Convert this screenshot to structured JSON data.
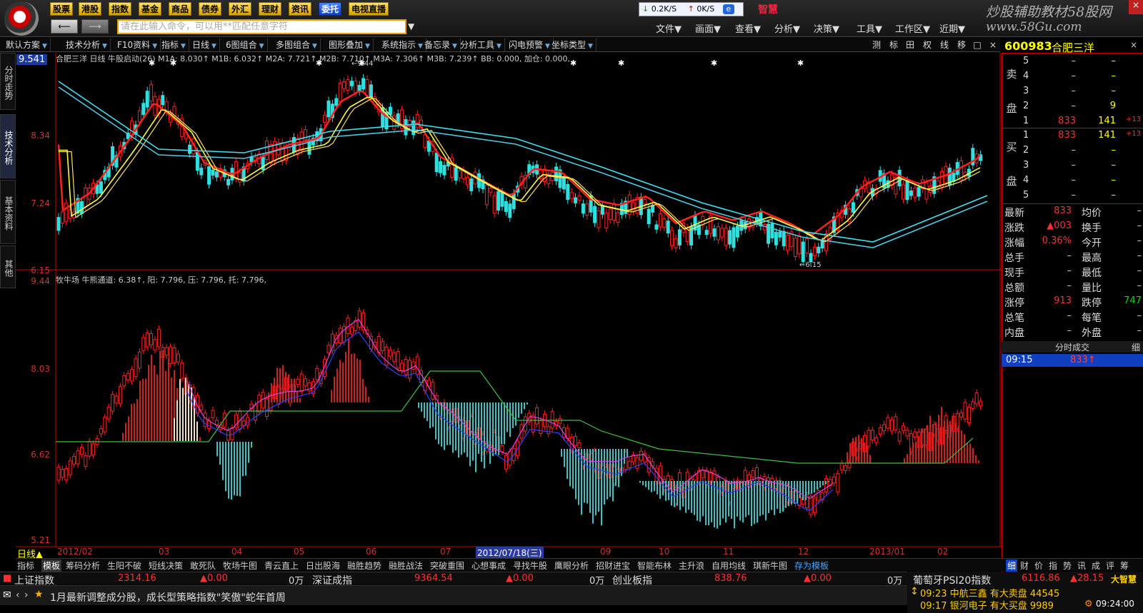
{
  "topbar": {
    "buttons": [
      "股票",
      "港股",
      "指数",
      "基金",
      "商品",
      "债券",
      "外汇",
      "理财",
      "资讯",
      "委托",
      "电视直播"
    ],
    "search_placeholder": "请在此输入命令，可以用**匹配任意字符",
    "speed_down": "0.2K/S",
    "speed_up": "0K/S",
    "brand": "智慧",
    "menus": [
      "文件▼",
      "画面▼",
      "查看▼",
      "分析▼",
      "决策▼",
      "工具▼",
      "工作区▼",
      "近期▼"
    ],
    "site_title": "炒股辅助教材58股网",
    "site_url": "www.58Gu.com"
  },
  "toolbar": {
    "items": [
      "默认方案",
      "技术分析",
      "F10资料",
      "指标",
      "日线",
      "6图组合",
      "多图组合",
      "图形叠加",
      "系统指示",
      "备忘录",
      "分析工具",
      "闪电预警",
      "坐标类型"
    ],
    "right_items": [
      "测",
      "标",
      "田",
      "权",
      "线",
      "移",
      "□",
      "×"
    ]
  },
  "left_tabs": [
    "分时走势",
    "技术分析",
    "基本资料",
    "其他"
  ],
  "upper_chart": {
    "title": "合肥三洋 日线  牛股启动(26)  M1A: 8.030↑ M1B: 6.032↑ M2A: 7.721↑ M2B: 7.710↑ M3A: 7.306↑ M3B: 7.239↑ BB: 0.000, 加仓: 0.000,",
    "price_label": "9.541",
    "y_labels": [
      "8.34",
      "7.24",
      "6.15"
    ],
    "high_marker": "9.44",
    "low_marker": "6.15"
  },
  "lower_chart": {
    "title": "牧牛场  牛熊通道: 6.38↑, 阳: 7.796, 压: 7.796, 托: 7.796,",
    "y_labels": [
      "9.44",
      "8.03",
      "6.62",
      "5.21"
    ]
  },
  "date_bar": {
    "period": "日线▲",
    "labels": [
      "2012/02",
      "03",
      "04",
      "05",
      "06",
      "07",
      "2012/07/18(三)",
      "09",
      "10",
      "11",
      "12",
      "2013/01",
      "02"
    ]
  },
  "bottom_tabs": [
    "指标",
    "模板",
    "筹码分析",
    "生阳不破",
    "短线决策",
    "敢死队",
    "牧场牛图",
    "青云直上",
    "日出股海",
    "融胜趋势",
    "融胜战法",
    "突破重围",
    "心想事成",
    "寻找牛股",
    "鹰眼分析",
    "招财进宝",
    "智能布林",
    "主升浪",
    "自用均线",
    "琪新牛图",
    "存为模板"
  ],
  "index_bar": {
    "sh_name": "上证指数",
    "sh_value": "2314.16",
    "sh_change": "▲0.00",
    "sh_vol": "0万",
    "sz_name": "深证成指",
    "sz_value": "9364.54",
    "sz_change": "▲0.00",
    "sz_vol": "0万",
    "cy_name": "创业板指",
    "cy_value": "838.76",
    "cy_change": "▲0.00",
    "cy_vol": "0万",
    "pt_name": "葡萄牙PSI20指数",
    "pt_value": "6116.86",
    "pt_change": "▲28.15"
  },
  "news": {
    "headline": "1月最新调整成分股，成长型策略指数\"笑傲\"蛇年首周",
    "alert1": "09:23 中航三鑫 有大卖盘 44545",
    "alert2": "09:17 银河电子 有大买盘 9989",
    "clock": "09:24:00",
    "dzh": "大智慧"
  },
  "right_panel": {
    "code": "600983",
    "name": "合肥三洋",
    "sell_label": "卖盘",
    "buy_label": "买盘",
    "sell_rows": [
      {
        "lvl": "5",
        "price": "–",
        "vol": "–"
      },
      {
        "lvl": "4",
        "price": "–",
        "vol": "–"
      },
      {
        "lvl": "3",
        "price": "–",
        "vol": "–"
      },
      {
        "lvl": "2",
        "price": "–",
        "vol": "9"
      },
      {
        "lvl": "1",
        "price": "833",
        "vol": "141",
        "chg": "+13"
      }
    ],
    "buy_rows": [
      {
        "lvl": "1",
        "price": "833",
        "vol": "141",
        "chg": "+13"
      },
      {
        "lvl": "2",
        "price": "–",
        "vol": "–"
      },
      {
        "lvl": "3",
        "price": "–",
        "vol": "–"
      },
      {
        "lvl": "4",
        "price": "–",
        "vol": "–"
      },
      {
        "lvl": "5",
        "price": "–",
        "vol": "–"
      }
    ],
    "stats": [
      {
        "l1": "最新",
        "v1": "833",
        "l2": "均价",
        "v2": "–"
      },
      {
        "l1": "涨跌",
        "v1": "▲003",
        "l2": "换手",
        "v2": "–"
      },
      {
        "l1": "涨幅",
        "v1": "0.36%",
        "l2": "今开",
        "v2": "–"
      },
      {
        "l1": "总手",
        "v1": "–",
        "l2": "最高",
        "v2": "–"
      },
      {
        "l1": "现手",
        "v1": "–",
        "l2": "最低",
        "v2": "–"
      },
      {
        "l1": "总额",
        "v1": "–",
        "l2": "量比",
        "v2": "–"
      },
      {
        "l1": "涨停",
        "v1": "913",
        "l2": "跌停",
        "v2": "747"
      },
      {
        "l1": "总笔",
        "v1": "–",
        "l2": "每笔",
        "v2": "–"
      },
      {
        "l1": "内盘",
        "v1": "–",
        "l2": "外盘",
        "v2": "–"
      }
    ],
    "trade_title": "分时成交",
    "trade_tab": "细",
    "tick_time": "09:15",
    "tick_price": "833↑",
    "tabs": [
      "细",
      "财",
      "价",
      "指",
      "势",
      "讯",
      "成",
      "评",
      "筹"
    ]
  }
}
